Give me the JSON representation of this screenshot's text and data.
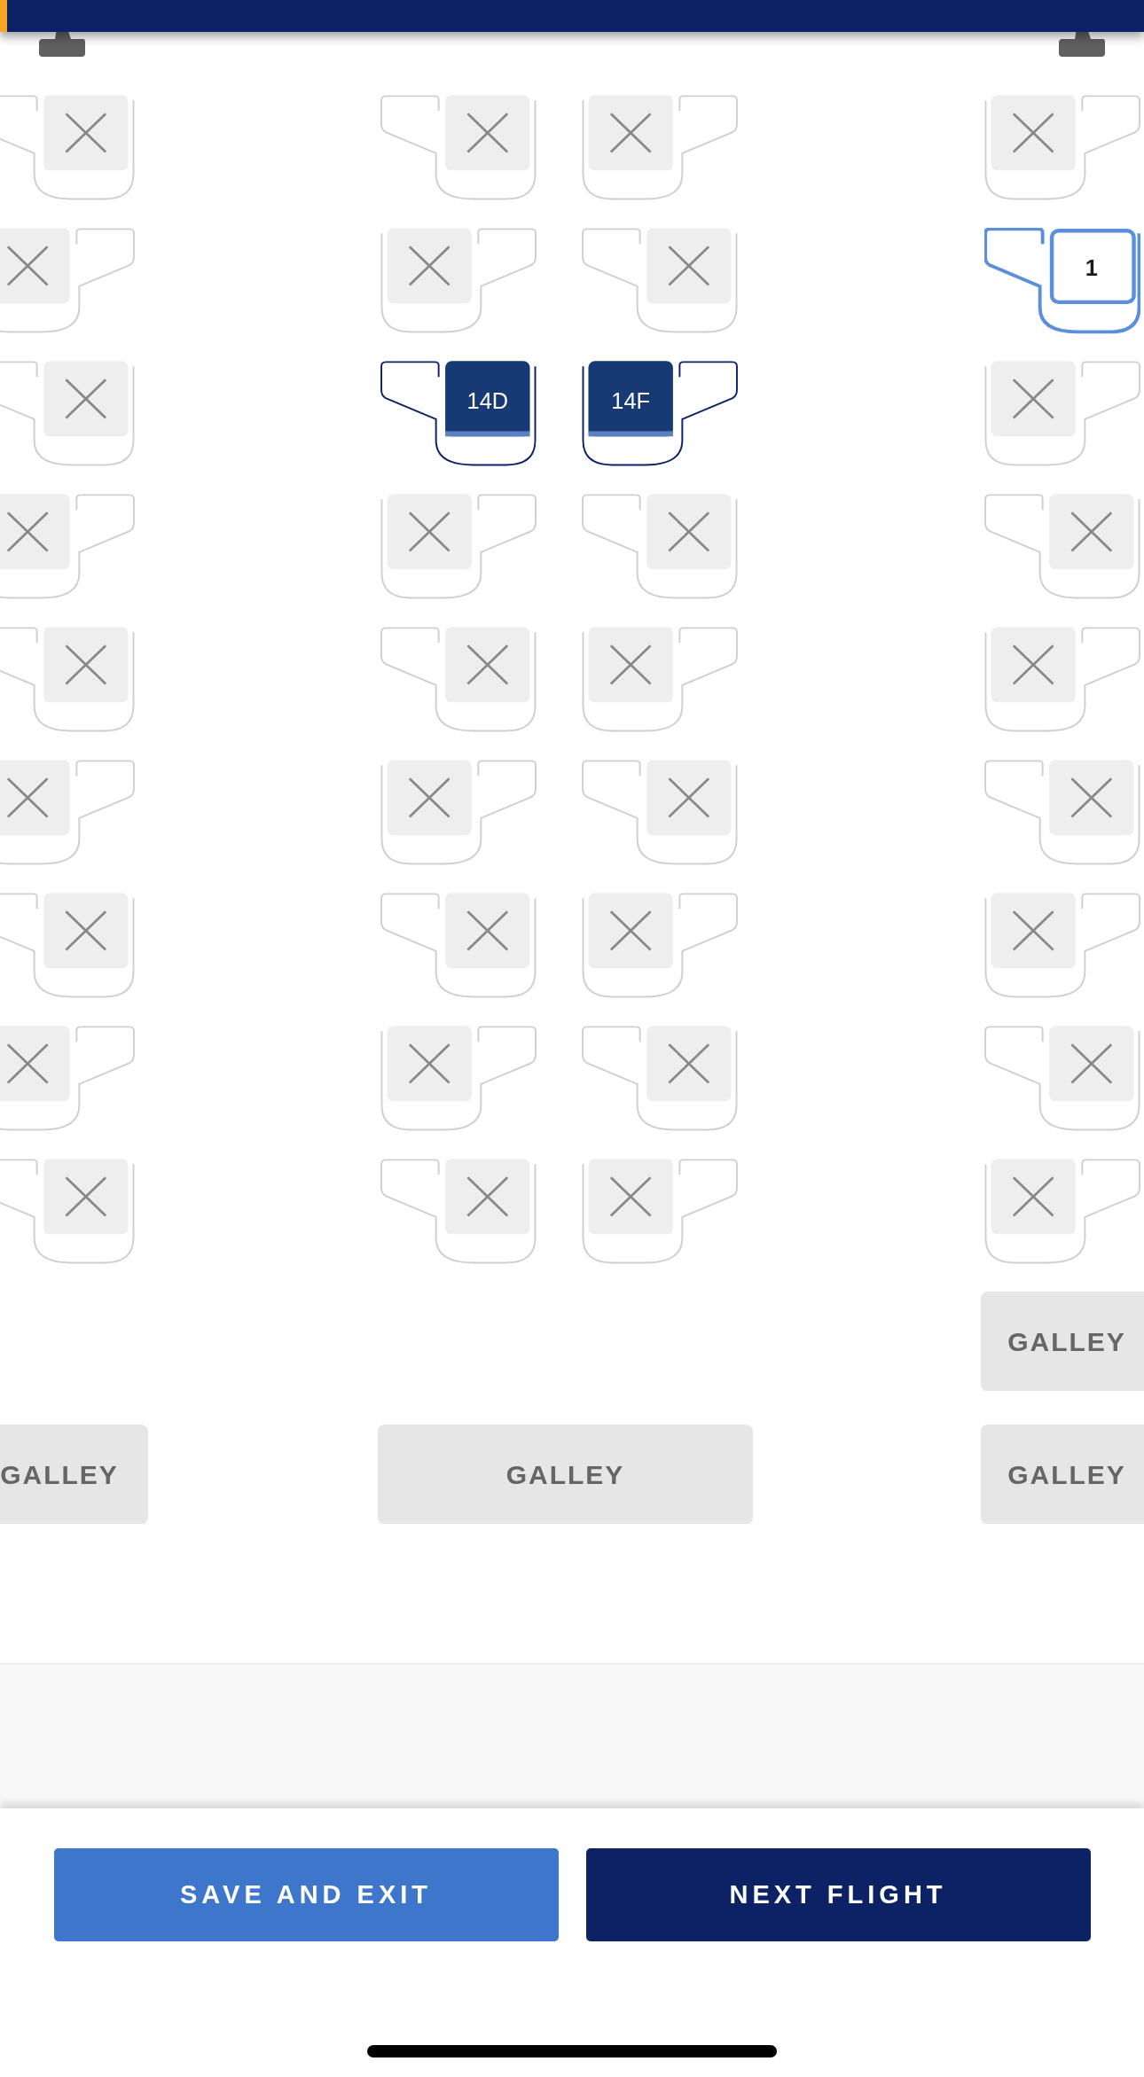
{
  "seat_rows": [
    {
      "seats": [
        {
          "kind": "blocked",
          "wing_left": true
        },
        {
          "kind": "blocked",
          "wing_left": true
        },
        {
          "kind": "blocked",
          "wing_left": false
        },
        {
          "kind": "blocked",
          "wing_left": false
        }
      ]
    },
    {
      "seats": [
        {
          "kind": "blocked",
          "wing_left": false
        },
        {
          "kind": "blocked",
          "wing_left": false
        },
        {
          "kind": "blocked",
          "wing_left": true
        },
        {
          "kind": "current",
          "wing_left": true,
          "label": "1"
        }
      ]
    },
    {
      "seats": [
        {
          "kind": "blocked",
          "wing_left": true
        },
        {
          "kind": "selected",
          "wing_left": true,
          "label": "14D"
        },
        {
          "kind": "selected",
          "wing_left": false,
          "label": "14F"
        },
        {
          "kind": "blocked",
          "wing_left": false
        }
      ]
    },
    {
      "seats": [
        {
          "kind": "blocked",
          "wing_left": false
        },
        {
          "kind": "blocked",
          "wing_left": false
        },
        {
          "kind": "blocked",
          "wing_left": true
        },
        {
          "kind": "blocked",
          "wing_left": true
        }
      ]
    },
    {
      "seats": [
        {
          "kind": "blocked",
          "wing_left": true
        },
        {
          "kind": "blocked",
          "wing_left": true
        },
        {
          "kind": "blocked",
          "wing_left": false
        },
        {
          "kind": "blocked",
          "wing_left": false
        }
      ]
    },
    {
      "seats": [
        {
          "kind": "blocked",
          "wing_left": false
        },
        {
          "kind": "blocked",
          "wing_left": false
        },
        {
          "kind": "blocked",
          "wing_left": true
        },
        {
          "kind": "blocked",
          "wing_left": true
        }
      ]
    },
    {
      "seats": [
        {
          "kind": "blocked",
          "wing_left": true
        },
        {
          "kind": "blocked",
          "wing_left": true
        },
        {
          "kind": "blocked",
          "wing_left": false
        },
        {
          "kind": "blocked",
          "wing_left": false
        }
      ]
    },
    {
      "seats": [
        {
          "kind": "blocked",
          "wing_left": false
        },
        {
          "kind": "blocked",
          "wing_left": false
        },
        {
          "kind": "blocked",
          "wing_left": true
        },
        {
          "kind": "blocked",
          "wing_left": true
        }
      ]
    },
    {
      "seats": [
        {
          "kind": "blocked",
          "wing_left": true
        },
        {
          "kind": "blocked",
          "wing_left": true
        },
        {
          "kind": "blocked",
          "wing_left": false
        },
        {
          "kind": "blocked",
          "wing_left": false
        }
      ]
    }
  ],
  "galley_rows": [
    {
      "right": {
        "label": "GALLEY"
      }
    },
    {
      "left": {
        "label": "GALLEY"
      },
      "middle": {
        "label": "GALLEY"
      },
      "right": {
        "label": "GALLEY"
      }
    }
  ],
  "buttons": [
    {
      "label": "SAVE AND EXIT",
      "kind": "secondary"
    },
    {
      "label": "NEXT FLIGHT",
      "kind": "primary"
    }
  ]
}
